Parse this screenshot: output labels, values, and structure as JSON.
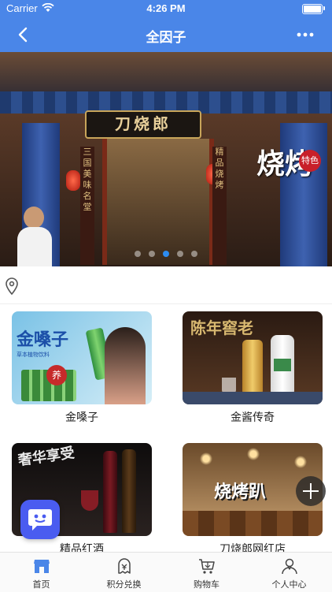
{
  "status_bar": {
    "carrier": "Carrier",
    "time": "4:26 PM"
  },
  "nav": {
    "title": "全因子",
    "back_icon": "chevron-left-icon",
    "more_icon": "more-dots-icon"
  },
  "banner": {
    "signboard": "刀烧郎",
    "promo": "烧烤",
    "promo_badge": "特色",
    "pillar_left": "三国美味名堂",
    "pillar_right": "精品烧烤",
    "slide_count": 5,
    "active_slide": 3
  },
  "location": {
    "icon": "location-pin-icon"
  },
  "cards": [
    {
      "label": "金嗓子",
      "art_text": "金嗓子",
      "art_sub": "草本植物饮料",
      "art_tag": "养"
    },
    {
      "label": "金酱传奇",
      "art_text": "陈年窖老"
    },
    {
      "label": "精品红酒",
      "art_text": "奢华享受"
    },
    {
      "label": "刀烧郎网红店",
      "art_text": "烧烤趴"
    }
  ],
  "tabs": [
    {
      "label": "首页",
      "icon": "store-icon",
      "active": true
    },
    {
      "label": "积分兑换",
      "icon": "coin-exchange-icon",
      "active": false
    },
    {
      "label": "购物车",
      "icon": "cart-icon",
      "active": false
    },
    {
      "label": "个人中心",
      "icon": "user-icon",
      "active": false
    }
  ],
  "colors": {
    "primary": "#4a86e8",
    "dot_active": "#2d8cf0",
    "chat_bubble": "#4a5cf0"
  }
}
